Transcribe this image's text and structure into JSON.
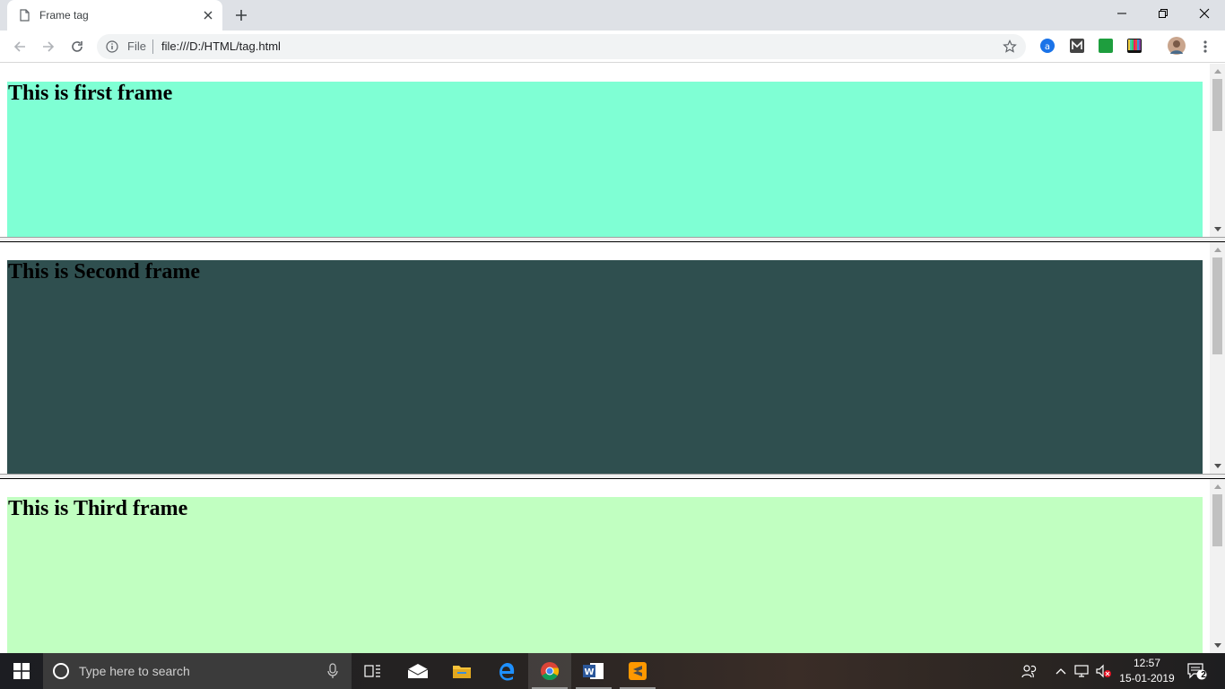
{
  "browser": {
    "tab_title": "Frame tag",
    "omnibox": {
      "scheme_label": "File",
      "url": "file:///D:/HTML/tag.html"
    }
  },
  "frames": [
    {
      "heading": "This is first frame",
      "bg_color": "#7fffd4"
    },
    {
      "heading": "This is Second frame",
      "bg_color": "#2f4f4f"
    },
    {
      "heading": "This is Third frame",
      "bg_color": "#c1ffc1"
    }
  ],
  "taskbar": {
    "search_placeholder": "Type here to search",
    "clock_time": "12:57",
    "clock_date": "15-01-2019",
    "notification_count": "2"
  },
  "icons": {
    "tab": [
      "page-icon",
      "close-icon",
      "new-tab-icon"
    ],
    "window": [
      "minimize-icon",
      "restore-icon",
      "close-window-icon"
    ],
    "toolbar": [
      "back-icon",
      "forward-icon",
      "reload-icon",
      "info-icon",
      "star-icon",
      "menu-icon"
    ],
    "extensions": [
      "extension-a-icon",
      "extension-m-icon",
      "extension-green-icon",
      "extension-color-bars-icon",
      "profile-avatar-icon"
    ],
    "taskbar": [
      "windows-start-icon",
      "cortana-icon",
      "microphone-icon",
      "task-view-icon",
      "mail-icon",
      "file-explorer-icon",
      "edge-icon",
      "chrome-icon",
      "word-icon",
      "sublime-text-icon"
    ],
    "tray": [
      "people-icon",
      "chevron-up-icon",
      "network-icon",
      "volume-muted-icon",
      "notifications-icon"
    ]
  }
}
